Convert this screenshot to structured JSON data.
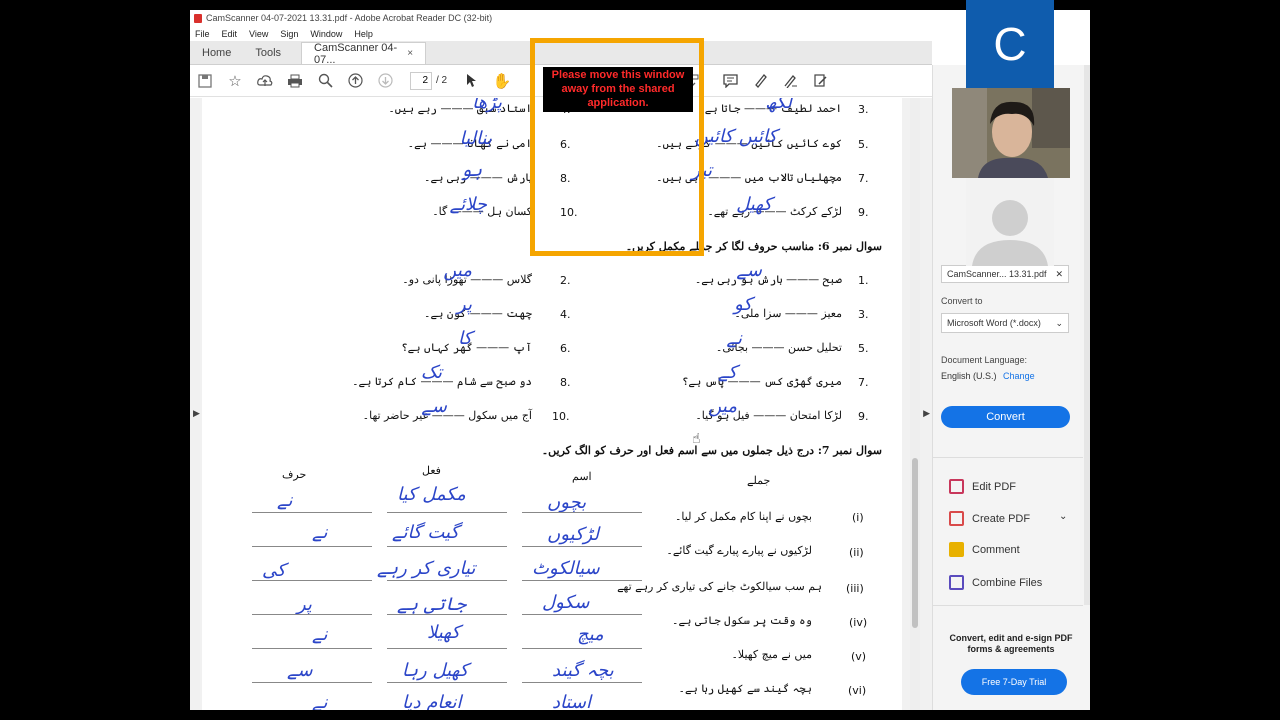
{
  "window": {
    "title": "CamScanner 04-07-2021 13.31.pdf - Adobe Acrobat Reader DC (32-bit)"
  },
  "menu": [
    "File",
    "Edit",
    "View",
    "Sign",
    "Window",
    "Help"
  ],
  "tabs": {
    "home": "Home",
    "tools": "Tools",
    "doc": "CamScanner 04-07...",
    "close": "×"
  },
  "toolbar": {
    "page_current": "2",
    "page_total": "/ 2"
  },
  "share_warning": "Please move this window away from the shared application.",
  "doc": {
    "top_lines": [
      {
        "n": "3.",
        "text": "احمد لطیف ——— جاتا ہے۔",
        "hw": "لکھ"
      },
      {
        "n": "4.",
        "text": "استاد سبق ——— رہے ہیں۔",
        "hw": "پڑھا"
      },
      {
        "n": "5.",
        "text": "کوے کائیں کائیں ——— کرتے ہیں۔",
        "hw": "کائیں کائیں"
      },
      {
        "n": "6.",
        "text": "امی نے کھانا ——— ہے۔",
        "hw": "بنالیا"
      },
      {
        "n": "7.",
        "text": "مچھلیاں تالاب میں ——— رہی ہیں۔",
        "hw": "تیر"
      },
      {
        "n": "8.",
        "text": "بارش ——— رہی ہے۔",
        "hw": "ہو"
      },
      {
        "n": "9.",
        "text": "لڑکے کرکٹ ——— رہے تھے۔",
        "hw": "کھیل"
      },
      {
        "n": "10.",
        "text": "کسان ہل ——— گا۔",
        "hw": "چلائے"
      }
    ],
    "q6_title": "سوال نمبر 6: مناسب حروف لگا کر جملے مکمل کریں۔",
    "q6_lines": [
      {
        "n": "1.",
        "text": "صبح ——— بارش ہو رہی ہے۔",
        "hw": "سے"
      },
      {
        "n": "2.",
        "text": "گلاس ——— تھوڑا پانی دو۔",
        "hw": "میں"
      },
      {
        "n": "3.",
        "text": "معیز ——— سزا ملی۔",
        "hw": "کو"
      },
      {
        "n": "4.",
        "text": "چھت ——— کون ہے۔",
        "hw": "پر"
      },
      {
        "n": "5.",
        "text": "تحلیل حسن ——— بجائی۔",
        "hw": "نے"
      },
      {
        "n": "6.",
        "text": "آپ ——— گھر کہاں ہے؟",
        "hw": "کا"
      },
      {
        "n": "7.",
        "text": "میری گھڑی کس ——— پاس ہے؟",
        "hw": "کے"
      },
      {
        "n": "8.",
        "text": "دو صبح سے شام ——— کام کرتا ہے۔",
        "hw": "تک"
      },
      {
        "n": "9.",
        "text": "لڑکا امتحان ——— فیل ہو گیا۔",
        "hw": "میں"
      },
      {
        "n": "10.",
        "text": "آج میں سکول ——— غیر حاضر تھا۔",
        "hw": "سے"
      }
    ],
    "q7_title": "سوال نمبر 7: درج ذیل جملوں میں سے اسم فعل اور حرف کو الگ کریں۔",
    "q7_headers": {
      "harf": "حرف",
      "fel": "فعل",
      "ism": "اسم",
      "jumlay": "جملے"
    },
    "q7_rows": [
      {
        "n": "(i)",
        "text": "بچوں نے اپنا کام مکمل کر لیا۔",
        "ism": "بچوں",
        "fel": "مکمل کیا",
        "harf": "نے"
      },
      {
        "n": "(ii)",
        "text": "لڑکیوں نے پیارے پیارے گیت گائے۔",
        "ism": "لڑکیوں",
        "fel": "گیت گائے",
        "harf": "نے"
      },
      {
        "n": "(iii)",
        "text": "ہم سب سیالکوٹ جانے کی تیاری کر رہے تھے",
        "ism": "سیالکوٹ",
        "fel": "تیاری کر رہے",
        "harf": "کی"
      },
      {
        "n": "(iv)",
        "text": "وہ وقت پر سکول جاتی ہے۔",
        "ism": "سکول",
        "fel": "جاتی ہے",
        "harf": "پر"
      },
      {
        "n": "(v)",
        "text": "میں نے میچ کھیلا۔",
        "ism": "میچ",
        "fel": "کھیلا",
        "harf": "نے"
      },
      {
        "n": "(vi)",
        "text": "بچہ گیند سے کھیل رہا ہے۔",
        "ism": "بچہ گیند",
        "fel": "کھیل رہا",
        "harf": "سے"
      },
      {
        "n": "",
        "text": "",
        "ism": "استاد",
        "fel": "انعام دیا",
        "harf": "نے"
      }
    ]
  },
  "right_panel": {
    "file_chip": "CamScanner... 13.31.pdf",
    "convert_to_label": "Convert to",
    "convert_to_value": "Microsoft Word (*.docx)",
    "doc_language_label": "Document Language:",
    "doc_language_value": "English (U.S.)",
    "change": "Change",
    "convert": "Convert",
    "tools": [
      {
        "label": "Edit PDF",
        "color": "#c8375b"
      },
      {
        "label": "Create PDF",
        "color": "#d94a4a"
      },
      {
        "label": "Comment",
        "color": "#e8b100"
      },
      {
        "label": "Combine Files",
        "color": "#5a4bbd"
      }
    ],
    "promo": "Convert, edit and e-sign PDF forms & agreements",
    "trial": "Free 7-Day Trial"
  },
  "call": {
    "initial": "C"
  },
  "colors": {
    "acrobat_blue": "#1473e6",
    "share_border": "#f5a500",
    "handwriting": "#2b45c8",
    "participant_tile": "#0f5cad"
  }
}
